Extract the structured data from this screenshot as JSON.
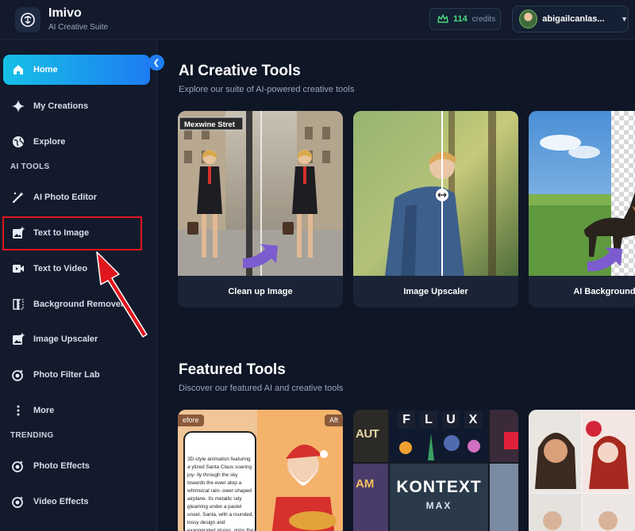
{
  "header": {
    "app_name": "Imivo",
    "app_subtitle": "AI Creative Suite",
    "credits_count": "114",
    "credits_label": "credits",
    "user_name": "abigailcanlas..."
  },
  "sidebar": {
    "items": [
      {
        "label": "Home",
        "icon": "home-icon",
        "active": true
      },
      {
        "label": "My Creations",
        "icon": "sparkle-icon"
      },
      {
        "label": "Explore",
        "icon": "globe-icon"
      }
    ],
    "ai_tools_title": "AI TOOLS",
    "ai_tools": [
      {
        "label": "AI Photo Editor",
        "icon": "magic-wand-icon"
      },
      {
        "label": "Text to Image",
        "icon": "image-plus-icon"
      },
      {
        "label": "Text to Video",
        "icon": "video-icon"
      },
      {
        "label": "Background Remover",
        "icon": "split-icon"
      },
      {
        "label": "Image Upscaler",
        "icon": "image-upscale-icon"
      },
      {
        "label": "Photo Filter Lab",
        "icon": "filter-icon"
      },
      {
        "label": "More",
        "icon": "more-vertical-icon"
      }
    ],
    "trending_title": "TRENDING",
    "trending": [
      {
        "label": "Photo Effects",
        "icon": "effects-icon"
      },
      {
        "label": "Video Effects",
        "icon": "video-effects-icon"
      }
    ]
  },
  "main": {
    "creative_title": "AI Creative Tools",
    "creative_subtitle": "Explore our suite of AI-powered creative tools",
    "tools": [
      {
        "label": "Clean up Image"
      },
      {
        "label": "Image Upscaler"
      },
      {
        "label": "AI Background Re"
      }
    ],
    "street_sign": "Mexwine Stret",
    "featured_title": "Featured Tools",
    "featured_subtitle": "Discover our featured AI and creative tools",
    "featured_before": "efore",
    "featured_after": "Aft",
    "featured_prompt": "3D-style animation featuring a ylized Santa Claus soaring joy- lly through the sky towards the ewer atop a whimsical rain- ower-shaped airplane. Its metallic ody gleaming under a pastel unset. Santa, with a rounded, lossy design and exaggerated atures, grips the handlebars ar",
    "flux_letters": [
      "F",
      "L",
      "U",
      "X"
    ],
    "kontext_title": "KONTEXT",
    "kontext_sub": "MAX",
    "aut_text": "AUT",
    "am_text": "AM"
  },
  "colors": {
    "accent_start": "#16c0e6",
    "accent_end": "#1d7cf2",
    "credits_green": "#4ade80",
    "highlight_red": "#e0161e"
  }
}
